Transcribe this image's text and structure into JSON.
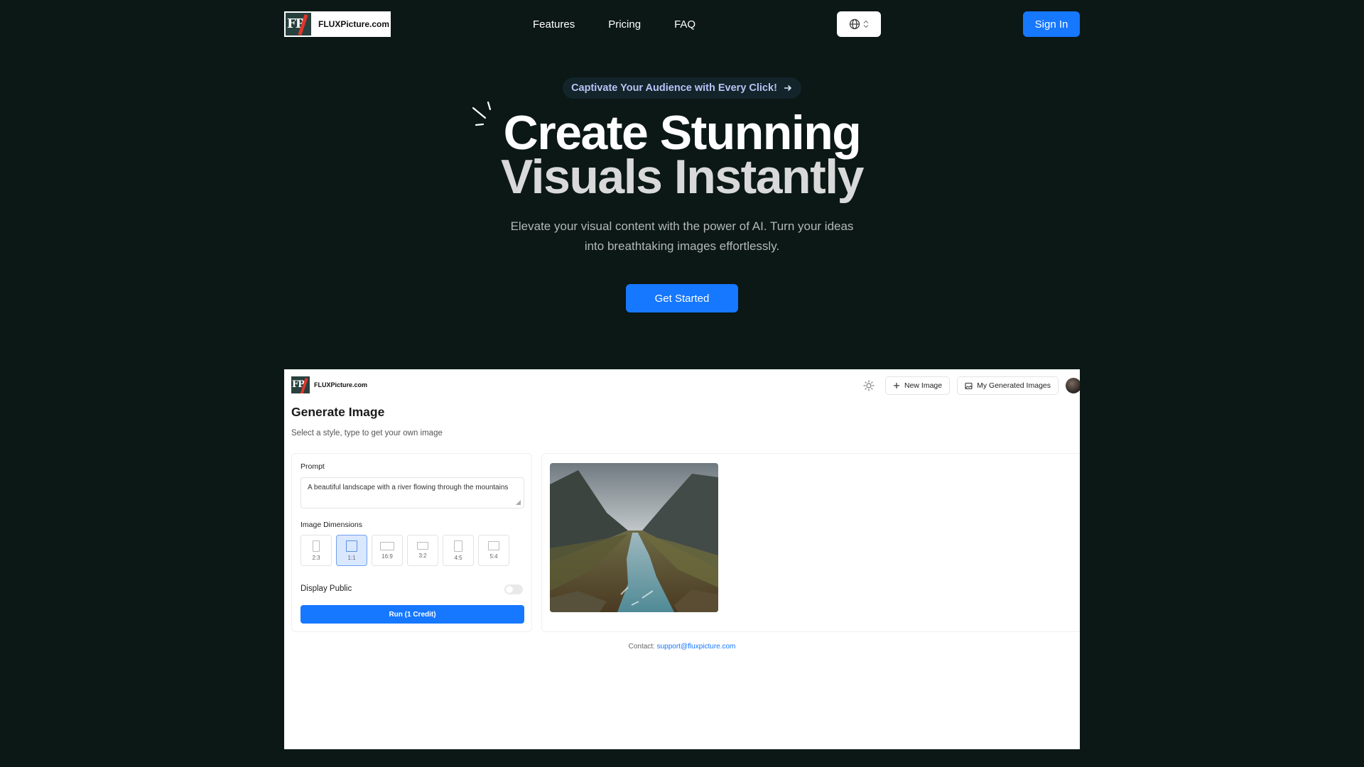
{
  "nav": {
    "logo_text": "FLUXPicture.com",
    "links": [
      "Features",
      "Pricing",
      "FAQ"
    ],
    "language_icon": "globe-icon",
    "signin_label": "Sign In"
  },
  "hero": {
    "announcement": "Captivate Your Audience with Every Click!",
    "title_line1": "Create Stunning",
    "title_line2": "Visuals Instantly",
    "subtitle_line1": "Elevate your visual content with the power of AI. Turn your ideas",
    "subtitle_line2": "into breathtaking images effortlessly.",
    "cta_label": "Get Started"
  },
  "preview": {
    "logo_text": "FLUXPicture.com",
    "new_image_label": "New Image",
    "my_images_label": "My Generated Images",
    "title": "Generate Image",
    "subtitle": "Select a style, type to get your own image",
    "prompt_label": "Prompt",
    "prompt_value": "A beautiful landscape with a river flowing through the mountains",
    "dimensions_label": "Image Dimensions",
    "ratios": [
      "2:3",
      "1:1",
      "16:9",
      "3:2",
      "4:5",
      "5:4"
    ],
    "selected_ratio": "1:1",
    "display_public_label": "Display Public",
    "display_public_on": false,
    "run_label": "Run (1 Credit)",
    "contact_label": "Contact:",
    "contact_email": "support@fluxpicture.com"
  },
  "colors": {
    "background": "#0b1816",
    "accent": "#1677ff",
    "announcement_text": "#b7c3f5"
  }
}
